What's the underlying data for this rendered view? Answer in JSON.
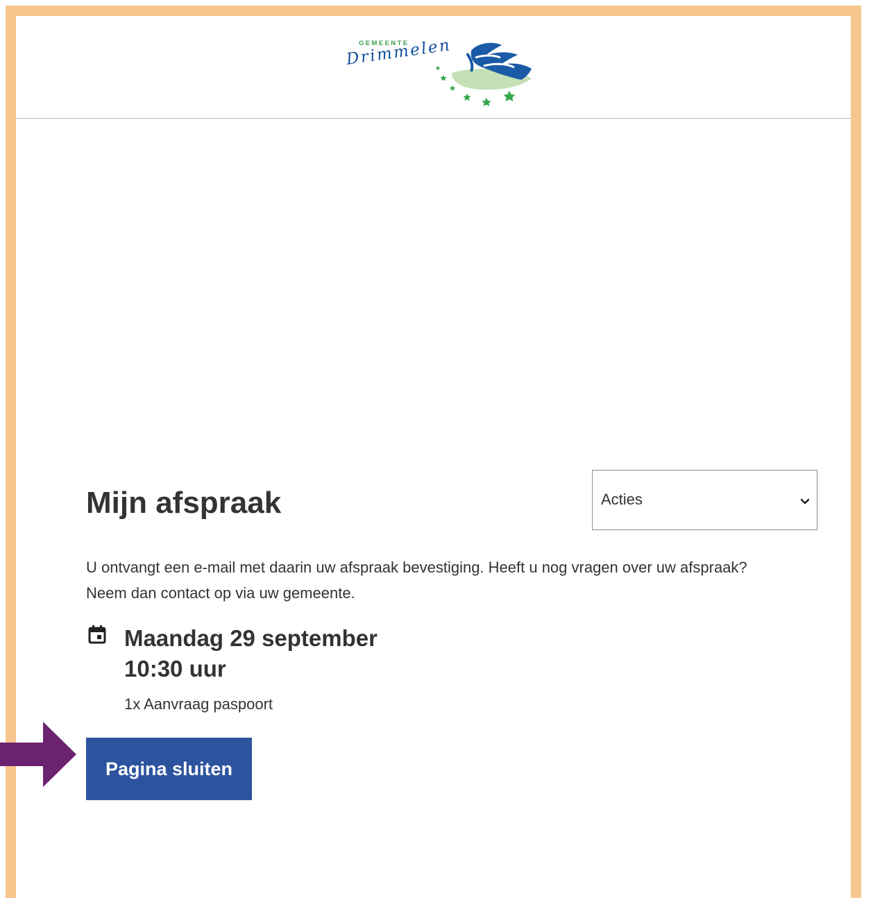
{
  "header": {
    "logo": {
      "municipality_prefix": "GEMEENTE",
      "municipality_name": "Drimmelen",
      "colors": {
        "text": "#12509a",
        "prefix": "#3a9d4d",
        "wave_blue": "#1a5aa6",
        "wave_green": "#c5dfb7",
        "stars": "#35a84a"
      }
    }
  },
  "actions": {
    "selected_label": "Acties"
  },
  "page": {
    "title": "Mijn afspraak",
    "intro": "U ontvangt een e-mail met daarin uw afspraak bevestiging. Heeft u nog vragen over uw afspraak? Neem dan contact op via uw gemeente."
  },
  "appointment": {
    "date": "Maandag 29 september",
    "time": "10:30 uur",
    "product": "1x Aanvraag paspoort"
  },
  "close_button": {
    "label": "Pagina sluiten"
  },
  "icons": {
    "calendar": "calendar-icon",
    "dropdown": "chevron-down-icon",
    "pointer": "arrow-right-icon"
  },
  "colors": {
    "frame_border": "#f5c68e",
    "primary_button": "#2d539e",
    "text": "#333333",
    "arrow": "#6b2270"
  }
}
